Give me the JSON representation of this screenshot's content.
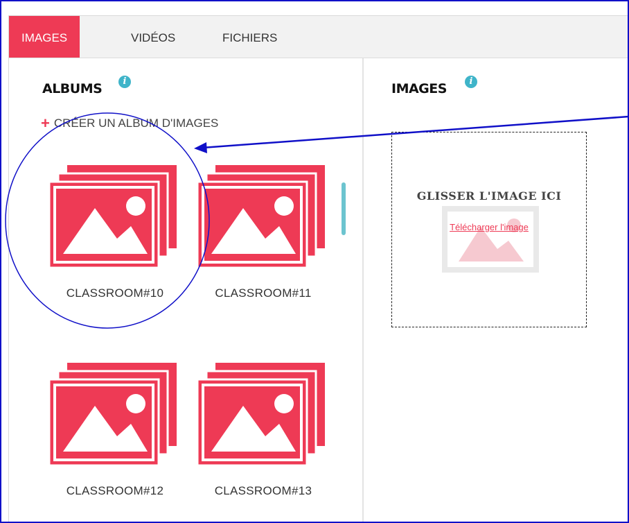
{
  "tabs": [
    {
      "label": "IMAGES",
      "active": true
    },
    {
      "label": "VIDÉOS",
      "active": false
    },
    {
      "label": "FICHIERS",
      "active": false
    }
  ],
  "albums_panel": {
    "title": "ALBUMS",
    "create_label": "CRÉER UN ALBUM D'IMAGES",
    "albums": [
      {
        "name": "CLASSROOM#10"
      },
      {
        "name": "CLASSROOM#11"
      },
      {
        "name": "CLASSROOM#12"
      },
      {
        "name": "CLASSROOM#13"
      }
    ]
  },
  "images_panel": {
    "title": "IMAGES",
    "drop_text": "GLISSER L'IMAGE ICI",
    "upload_link": "Télécharger l'image"
  },
  "colors": {
    "accent": "#ee3a55",
    "info": "#3fb4c9",
    "annotation": "#1010c8"
  },
  "icons": {
    "info": "info-icon",
    "plus": "plus-icon",
    "album": "image-stack-icon",
    "placeholder": "image-placeholder-icon"
  }
}
